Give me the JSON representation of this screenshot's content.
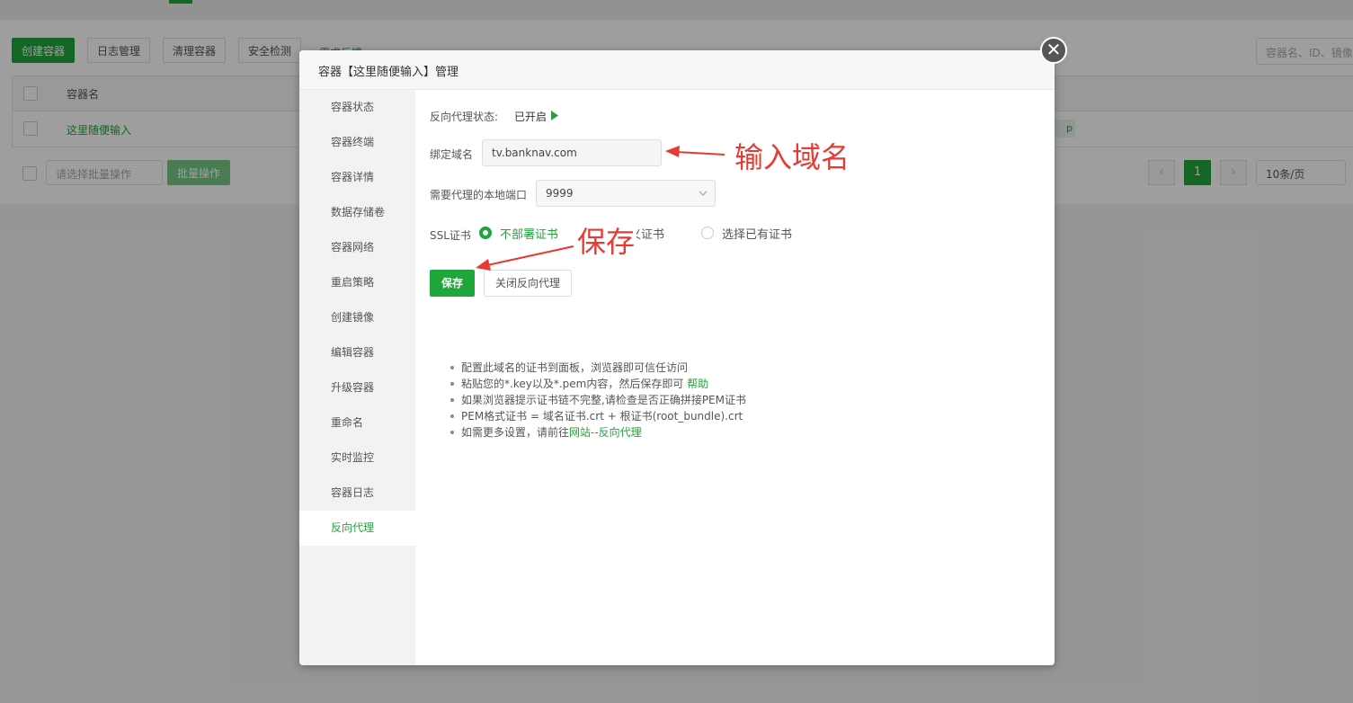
{
  "background": {
    "toolbar_buttons": [
      "创建容器",
      "日志管理",
      "清理容器",
      "安全检测"
    ],
    "toolbar_link": "需求反馈",
    "search_placeholder": "容器名、ID、镜像",
    "table_header": "容器名",
    "row_name": "这里随便输入",
    "row_badge": "p",
    "batch_select_placeholder": "请选择批量操作",
    "batch_button": "批量操作",
    "pagination": {
      "prev": "‹",
      "current": "1",
      "next": "›",
      "page_size": "10条/页"
    }
  },
  "dialog": {
    "title": "容器【这里随便输入】管理",
    "close_glyph": "✕",
    "sidebar": [
      "容器状态",
      "容器终端",
      "容器详情",
      "数据存储卷",
      "容器网络",
      "重启策略",
      "创建镜像",
      "编辑容器",
      "升级容器",
      "重命名",
      "实时监控",
      "容器日志",
      "反向代理"
    ],
    "active_index": 12,
    "proxy": {
      "status_label": "反向代理状态:",
      "status_value": "已开启",
      "domain_label": "绑定域名",
      "domain_value": "tv.banknav.com",
      "port_label": "需要代理的本地端口",
      "port_value": "9999",
      "ssl_label": "SSL证书",
      "ssl_options": [
        "不部署证书",
        "自定义证书",
        "选择已有证书"
      ],
      "ssl_selected": 0,
      "save_button": "保存",
      "close_proxy_button": "关闭反向代理",
      "tips": [
        {
          "text": "配置此域名的证书到面板，浏览器即可信任访问",
          "link": ""
        },
        {
          "text": "粘贴您的*.key以及*.pem内容，然后保存即可 ",
          "link": "帮助"
        },
        {
          "text": "如果浏览器提示证书链不完整,请检查是否正确拼接PEM证书",
          "link": ""
        },
        {
          "text": "PEM格式证书 = 域名证书.crt + 根证书(root_bundle).crt",
          "link": ""
        },
        {
          "text": "如需更多设置，请前往",
          "link": "网站--反向代理"
        }
      ]
    }
  },
  "annotations": {
    "domain_note": "输入域名",
    "save_note": "保存",
    "color": "#e83a32"
  },
  "colors": {
    "accent": "#20a53a"
  }
}
